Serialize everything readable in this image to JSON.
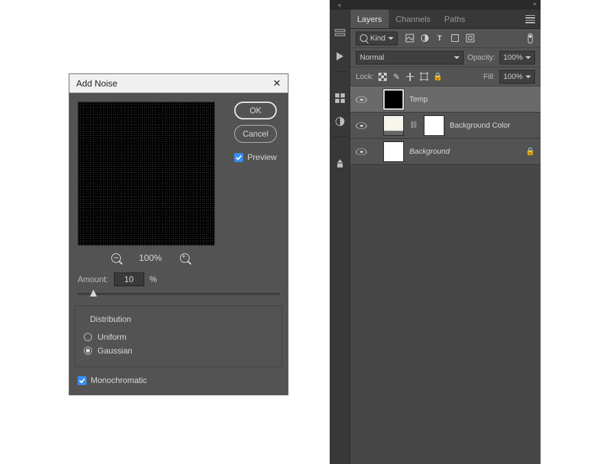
{
  "dialog": {
    "title": "Add Noise",
    "ok": "OK",
    "cancel": "Cancel",
    "preview_label": "Preview",
    "preview_checked": true,
    "zoom": "100%",
    "amount_label": "Amount:",
    "amount_value": "10",
    "amount_unit": "%",
    "distribution_label": "Distribution",
    "uniform_label": "Uniform",
    "gaussian_label": "Gaussian",
    "distribution_selected": "Gaussian",
    "mono_label": "Monochromatic",
    "mono_checked": true
  },
  "panel": {
    "collapse_left": "«",
    "expand_right": "»",
    "tabs": [
      "Layers",
      "Channels",
      "Paths"
    ],
    "active_tab": "Layers",
    "filter_kind": "Kind",
    "blend_mode": "Normal",
    "opacity_label": "Opacity:",
    "opacity_value": "100%",
    "lock_label": "Lock:",
    "fill_label": "Fill:",
    "fill_value": "100%",
    "layers": [
      {
        "name": "Temp",
        "selected": true,
        "visible": true,
        "thumb": "black",
        "mask": false,
        "locked": false,
        "italic": false
      },
      {
        "name": "Background Color",
        "selected": false,
        "visible": true,
        "thumb": "color",
        "mask": true,
        "locked": false,
        "italic": false
      },
      {
        "name": "Background",
        "selected": false,
        "visible": true,
        "thumb": "bg",
        "mask": false,
        "locked": true,
        "italic": true
      }
    ]
  }
}
